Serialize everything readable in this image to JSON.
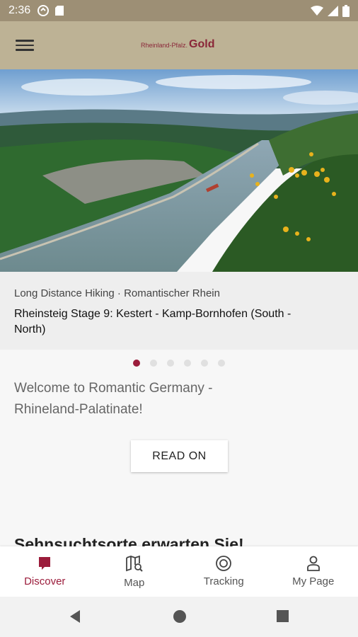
{
  "status_bar": {
    "time": "2:36"
  },
  "app_bar": {
    "logo_small": "Rheinland-Pfalz.",
    "logo_big": "Gold"
  },
  "hero": {
    "category": "Long Distance Hiking · Romantischer Rhein",
    "title": "Rheinsteig Stage 9: Kestert - Kamp-Bornhofen (South - North)",
    "active_slide": 1,
    "slide_count": 6
  },
  "main": {
    "welcome_text": "Welcome to Romantic Germany - Rhineland-Palatinate!",
    "read_on_label": "READ ON",
    "section_heading": "Sehnsuchtsorte erwarten Sie!"
  },
  "bottom_nav": {
    "items": [
      {
        "label": "Discover",
        "icon": "discover-icon",
        "active": true
      },
      {
        "label": "Map",
        "icon": "map-search-icon",
        "active": false
      },
      {
        "label": "Tracking",
        "icon": "tracking-icon",
        "active": false
      },
      {
        "label": "My Page",
        "icon": "person-icon",
        "active": false
      }
    ]
  },
  "colors": {
    "status_bar": "#9d8f75",
    "app_bar": "#bdb295",
    "accent": "#9b1c3b"
  }
}
